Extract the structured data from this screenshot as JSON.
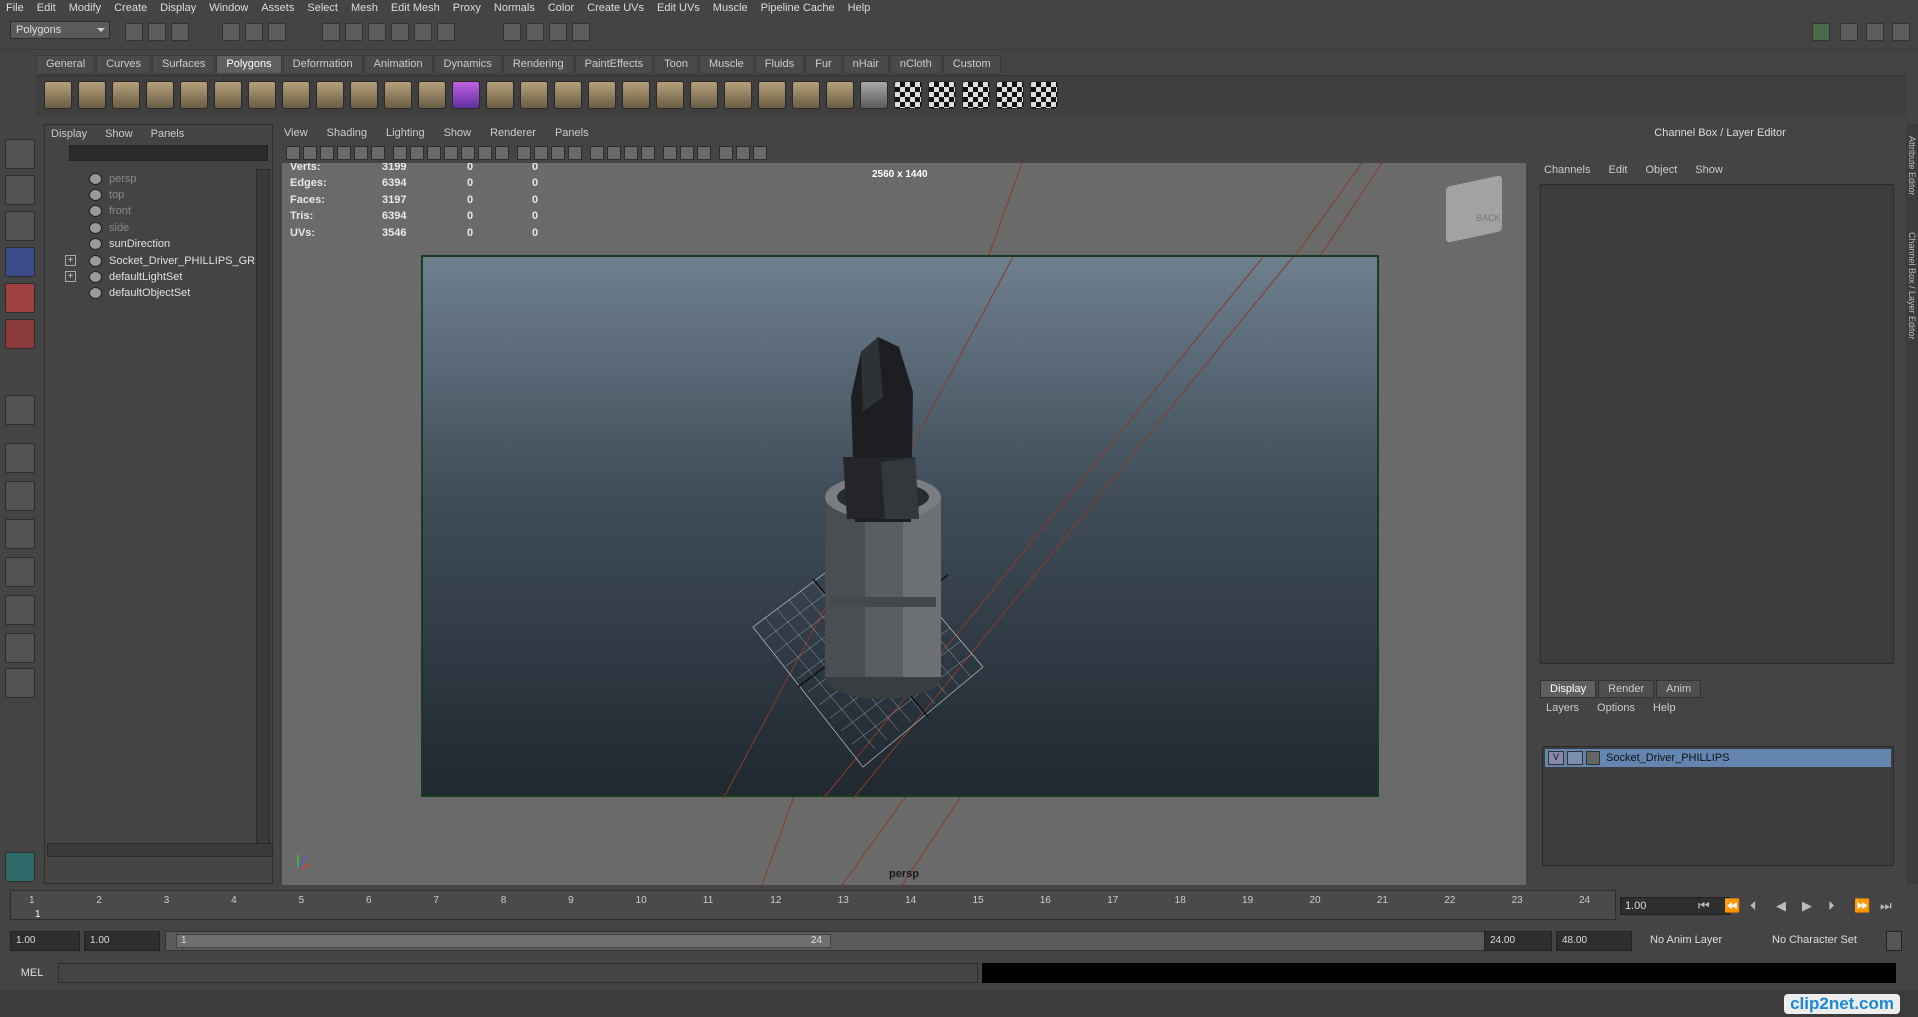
{
  "menubar": [
    "File",
    "Edit",
    "Modify",
    "Create",
    "Display",
    "Window",
    "Assets",
    "Select",
    "Mesh",
    "Edit Mesh",
    "Proxy",
    "Normals",
    "Color",
    "Create UVs",
    "Edit UVs",
    "Muscle",
    "Pipeline Cache",
    "Help"
  ],
  "mode_selector": "Polygons",
  "shelf_tabs": [
    "General",
    "Curves",
    "Surfaces",
    "Polygons",
    "Deformation",
    "Animation",
    "Dynamics",
    "Rendering",
    "PaintEffects",
    "Toon",
    "Muscle",
    "Fluids",
    "Fur",
    "nHair",
    "nCloth",
    "Custom"
  ],
  "active_shelf_tab": "Polygons",
  "outliner": {
    "menu": [
      "Display",
      "Show",
      "Panels"
    ],
    "items": [
      {
        "label": "persp",
        "dim": true,
        "expandable": false
      },
      {
        "label": "top",
        "dim": true,
        "expandable": false
      },
      {
        "label": "front",
        "dim": true,
        "expandable": false
      },
      {
        "label": "side",
        "dim": true,
        "expandable": false
      },
      {
        "label": "sunDirection",
        "dim": false,
        "expandable": false
      },
      {
        "label": "Socket_Driver_PHILLIPS_GRP",
        "dim": false,
        "expandable": true
      },
      {
        "label": "defaultLightSet",
        "dim": false,
        "expandable": true
      },
      {
        "label": "defaultObjectSet",
        "dim": false,
        "expandable": false
      }
    ]
  },
  "viewport": {
    "menu": [
      "View",
      "Shading",
      "Lighting",
      "Show",
      "Renderer",
      "Panels"
    ],
    "hud": [
      {
        "label": "Verts:",
        "v1": "3199",
        "v2": "0",
        "v3": "0"
      },
      {
        "label": "Edges:",
        "v1": "6394",
        "v2": "0",
        "v3": "0"
      },
      {
        "label": "Faces:",
        "v1": "3197",
        "v2": "0",
        "v3": "0"
      },
      {
        "label": "Tris:",
        "v1": "6394",
        "v2": "0",
        "v3": "0"
      },
      {
        "label": "UVs:",
        "v1": "3546",
        "v2": "0",
        "v3": "0"
      }
    ],
    "resolution": "2560 x 1440",
    "camera": "persp",
    "viewcube_label": "BACK"
  },
  "channel_box": {
    "title": "Channel Box / Layer Editor",
    "menu": [
      "Channels",
      "Edit",
      "Object",
      "Show"
    ]
  },
  "layer_editor": {
    "tabs": [
      "Display",
      "Render",
      "Anim"
    ],
    "active_tab": "Display",
    "menu": [
      "Layers",
      "Options",
      "Help"
    ],
    "layers": [
      {
        "visible": "V",
        "name": "Socket_Driver_PHILLIPS"
      }
    ]
  },
  "side_tabs": [
    "Attribute Editor",
    "Channel Box / Layer Editor"
  ],
  "timeline": {
    "ticks": [
      "1",
      "2",
      "3",
      "4",
      "5",
      "6",
      "7",
      "8",
      "9",
      "10",
      "11",
      "12",
      "13",
      "14",
      "15",
      "16",
      "17",
      "18",
      "19",
      "20",
      "21",
      "22",
      "23",
      "24"
    ],
    "current_frame": "1",
    "current_time_field": "1.00"
  },
  "range": {
    "start_time": "1.00",
    "playback_start": "1.00",
    "slider_start": "1",
    "slider_end": "24",
    "playback_end": "24.00",
    "end_time": "48.00",
    "anim_layer": "No Anim Layer",
    "character_set": "No Character Set"
  },
  "command_line": {
    "label": "MEL"
  },
  "watermark": "clip2net.com"
}
